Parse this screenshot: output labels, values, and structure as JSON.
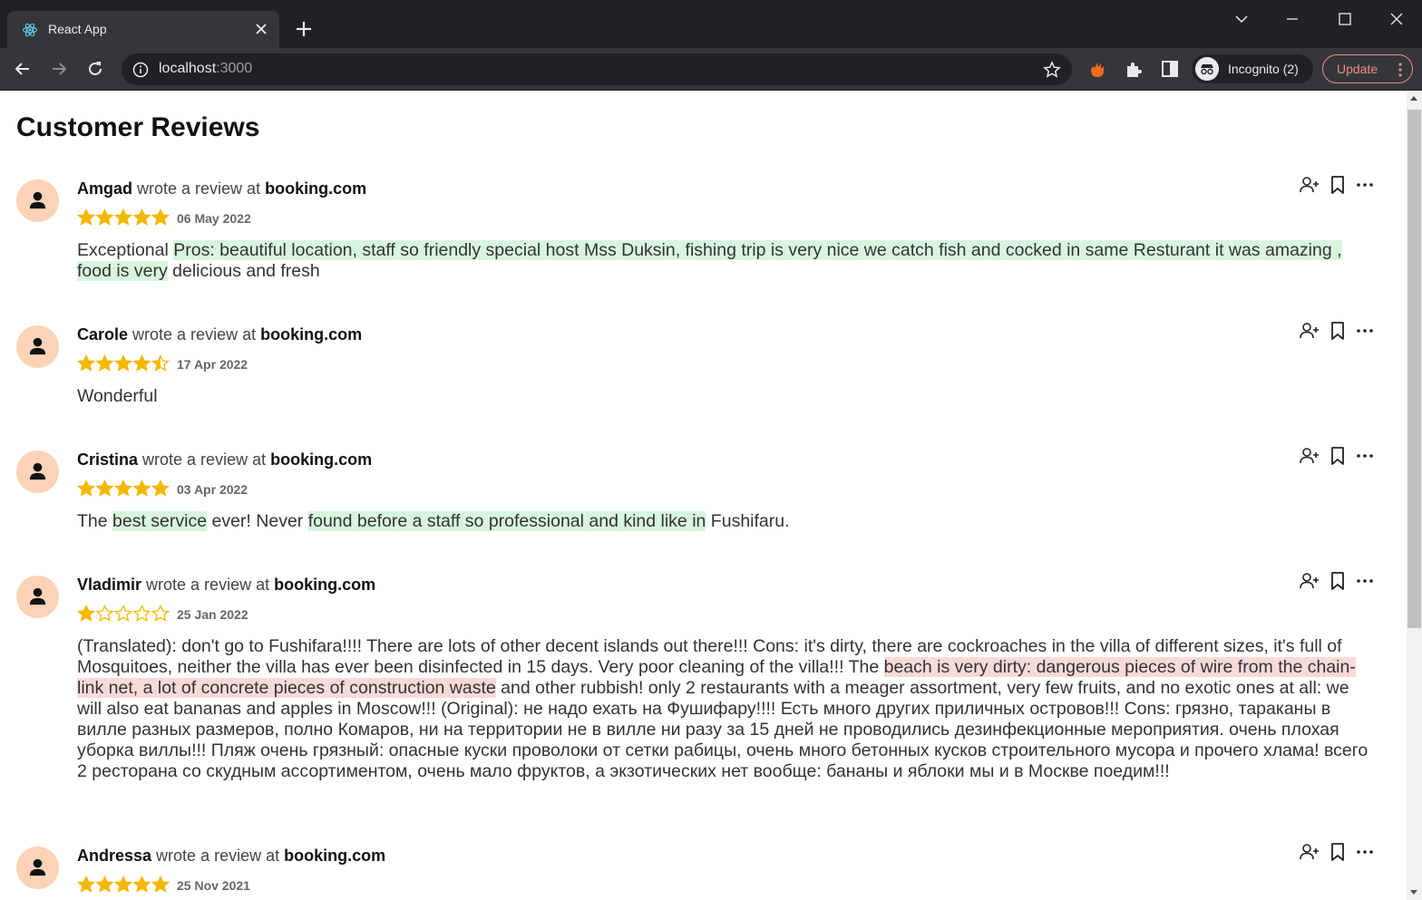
{
  "browser": {
    "tab_title": "React App",
    "url_host": "localhost",
    "url_port": ":3000",
    "profile_label": "Incognito (2)",
    "update_label": "Update",
    "accent_update": "#f28b82"
  },
  "page": {
    "title": "Customer Reviews"
  },
  "colors": {
    "star": "#f5b800",
    "avatar_bg": "#fcd3b6",
    "positive_highlight": "#d9f5df",
    "negative_highlight": "#f9dada"
  },
  "reviews": [
    {
      "author": "Amgad",
      "wrote_text": " wrote a review at ",
      "site": "booking.com",
      "rating": 5,
      "date": "06 May 2022",
      "segments": [
        {
          "text": "Exceptional ",
          "tone": "none"
        },
        {
          "text": "Pros: beautiful location, staff so friendly special host Mss Duksin, fishing trip is very nice we catch fish and cocked in same Resturant it was amazing , food is very",
          "tone": "positive"
        },
        {
          "text": " delicious and fresh",
          "tone": "none"
        }
      ]
    },
    {
      "author": "Carole",
      "wrote_text": " wrote a review at ",
      "site": "booking.com",
      "rating": 4.5,
      "date": "17 Apr 2022",
      "segments": [
        {
          "text": "Wonderful",
          "tone": "none"
        }
      ]
    },
    {
      "author": "Cristina",
      "wrote_text": " wrote a review at ",
      "site": "booking.com",
      "rating": 5,
      "date": "03 Apr 2022",
      "segments": [
        {
          "text": "The ",
          "tone": "none"
        },
        {
          "text": "best service",
          "tone": "positive"
        },
        {
          "text": " ever! Never ",
          "tone": "none"
        },
        {
          "text": "found before a staff so professional and kind like in",
          "tone": "positive"
        },
        {
          "text": " Fushifaru.",
          "tone": "none"
        }
      ]
    },
    {
      "author": "Vladimir",
      "wrote_text": " wrote a review at ",
      "site": "booking.com",
      "rating": 1,
      "date": "25 Jan 2022",
      "segments": [
        {
          "text": "(Translated): don't go to Fushifara!!!! There are lots of other decent islands out there!!! Cons: it's dirty, there are cockroaches in the villa of different sizes, it's full of Mosquitoes, neither the villa has ever been disinfected in 15 days. Very poor cleaning of the villa!!! The ",
          "tone": "none"
        },
        {
          "text": "beach is very dirty: dangerous pieces of wire from the chain-link net, a lot of concrete pieces of construction waste",
          "tone": "negative"
        },
        {
          "text": " and other rubbish! only 2 restaurants with a meager assortment, very few fruits, and no exotic ones at all: we will also eat bananas and apples in Moscow!!! (Original): не надо ехать на Фушифару!!!! Есть много других приличных островов!!! Cons: грязно, тараканы в вилле разных размеров, полно Комаров, ни на территории не в вилле ни разу за 15 дней не проводились дезинфекционные мероприятия. очень плохая уборка виллы!!! Пляж очень грязный: опасные куски проволоки от сетки рабицы, очень много бетонных кусков строительного мусора и прочего хлама! всего 2 ресторана со скудным ассортиментом, очень мало фруктов, а экзотических нет вообще: бананы и яблоки мы и в Москве поедим!!!",
          "tone": "none"
        }
      ]
    },
    {
      "author": "Andressa",
      "wrote_text": " wrote a review at ",
      "site": "booking.com",
      "rating": 5,
      "date": "25 Nov 2021",
      "segments": []
    }
  ]
}
